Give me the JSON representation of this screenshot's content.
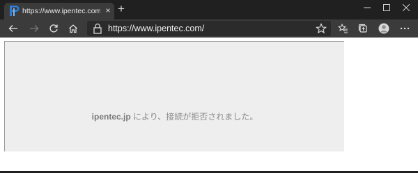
{
  "tab": {
    "title": "https://www.ipentec.com/open/",
    "close_glyph": "×",
    "favicon": "ipentec-logo-icon"
  },
  "tabstrip": {
    "new_tab_glyph": "+"
  },
  "address_bar": {
    "url": "https://www.ipentec.com/"
  },
  "error_page": {
    "host": "ipentec.jp",
    "message": " により、接続が拒否されました。"
  },
  "colors": {
    "tabstrip_bg": "#202020",
    "toolbar_bg": "#3b3b3b",
    "addressbar_bg": "#2b2b2b",
    "error_panel_bg": "#eeeeee",
    "error_text": "#8a8a8a",
    "accent_favicon": "#2f7fd8"
  },
  "icons": [
    "back-arrow-icon",
    "forward-arrow-icon",
    "refresh-icon",
    "home-icon",
    "lock-icon",
    "favorite-star-icon",
    "favorites-icon",
    "collections-icon",
    "profile-avatar-icon",
    "more-icon",
    "minimize-icon",
    "maximize-icon",
    "close-icon"
  ]
}
